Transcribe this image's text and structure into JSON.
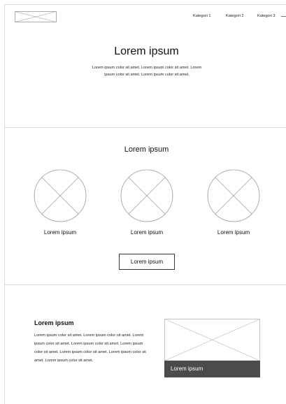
{
  "header": {
    "logo": "image-placeholder",
    "nav": [
      {
        "label": "Kategori 1"
      },
      {
        "label": "Kategori 2"
      },
      {
        "label": "Kategori 3"
      }
    ],
    "accent_color": "#e24a4a"
  },
  "hero": {
    "title": "Lorem ipsum",
    "text": "Lorem ipsum color sit amet. Lorem ipsum color sit amet. Lorem ipsum color sit amet. Lorem ipsum color sit amet."
  },
  "features": {
    "title": "Lorem ipsum",
    "items": [
      {
        "label": "Lorem ipsum",
        "icon": "image-placeholder-circle"
      },
      {
        "label": "Lorem ipsum",
        "icon": "image-placeholder-circle"
      },
      {
        "label": "Lorem ipsum",
        "icon": "image-placeholder-circle"
      }
    ],
    "button_label": "Lorem ipsum"
  },
  "bottom": {
    "title": "Lorem ipsum",
    "text": "Lorem ipsum color sit amet. Lorem ipsum color sit amet. Lorem ipsum color sit amet. Lorem ipsum color sit amet. Lorem ipsum color sit amet. Lorem ipsum color sit amet. Lorem ipsum color sit amet. Lorem ipsum color sit amet.",
    "card": {
      "image": "image-placeholder",
      "caption": "Lorem ipsum",
      "caption_bg": "#4b4b4b"
    }
  }
}
